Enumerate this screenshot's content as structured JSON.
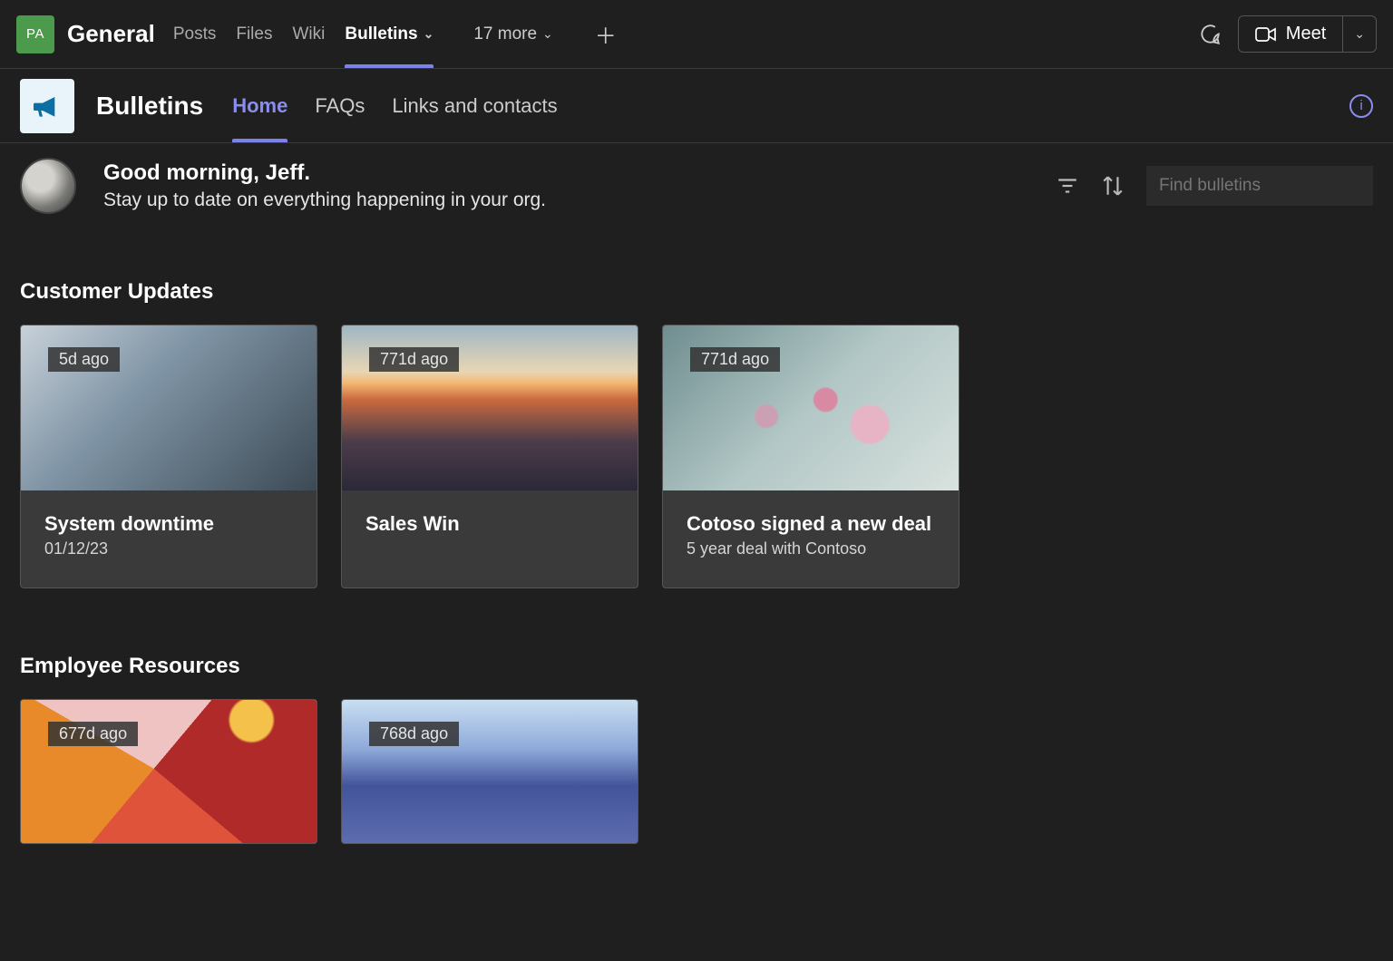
{
  "header": {
    "team_initials": "PA",
    "channel": "General",
    "tabs": [
      "Posts",
      "Files",
      "Wiki",
      "Bulletins"
    ],
    "active_tab_index": 3,
    "more_label": "17 more",
    "meet_label": "Meet"
  },
  "app": {
    "title": "Bulletins",
    "tabs": [
      "Home",
      "FAQs",
      "Links and contacts"
    ],
    "active_tab_index": 0
  },
  "greeting": {
    "hello": "Good morning, Jeff.",
    "sub": "Stay up to date on everything happening in your org.",
    "search_placeholder": "Find bulletins"
  },
  "sections": [
    {
      "title": "Customer Updates",
      "cards": [
        {
          "age": "5d ago",
          "title": "System downtime",
          "sub": "01/12/23",
          "img": "img-meeting"
        },
        {
          "age": "771d ago",
          "title": "Sales Win",
          "sub": "",
          "img": "img-sunset"
        },
        {
          "age": "771d ago",
          "title": "Cotoso signed a new deal",
          "sub": "5 year deal with Contoso",
          "img": "img-blossom"
        }
      ]
    },
    {
      "title": "Employee Resources",
      "cards": [
        {
          "age": "677d ago",
          "title": "",
          "sub": "",
          "img": "img-ribbon"
        },
        {
          "age": "768d ago",
          "title": "",
          "sub": "",
          "img": "img-render"
        }
      ]
    }
  ]
}
